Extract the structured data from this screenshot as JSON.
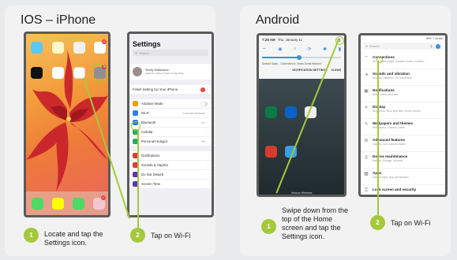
{
  "ios": {
    "title": "IOS – iPhone",
    "settings_title": "Settings",
    "search_placeholder": "Search",
    "profile_name": "Shelly Williamson",
    "profile_sub": "Apple ID, iCloud, iTunes & App Store",
    "finish_setup": "Finish Setting Up Your iPhone",
    "finish_badge": "1",
    "items": [
      {
        "label": "Airplane Mode",
        "value": "",
        "color": "#f39c12"
      },
      {
        "label": "Wi-Fi",
        "value": "Comcast Network",
        "color": "#2f80ed"
      },
      {
        "label": "Bluetooth",
        "value": "On",
        "color": "#2f80ed"
      },
      {
        "label": "Cellular",
        "value": "",
        "color": "#27ae60"
      },
      {
        "label": "Personal Hotspot",
        "value": "Off",
        "color": "#27ae60"
      }
    ],
    "items2": [
      {
        "label": "Notifications",
        "color": "#e53935"
      },
      {
        "label": "Sounds & Haptics",
        "color": "#e53935"
      },
      {
        "label": "Do Not Disturb",
        "color": "#5e35b1"
      },
      {
        "label": "Screen Time",
        "color": "#5e35b1"
      }
    ],
    "home_badges": [
      "12",
      "5",
      "17"
    ],
    "step1_number": "1",
    "step1_text": "Locate and tap the Settings icon.",
    "step2_number": "2",
    "step2_text": "Tap on Wi-Fi"
  },
  "android": {
    "title": "Android",
    "time": "7:25 AM",
    "date": "Thu, January 11",
    "notif_settings": "NOTIFICATION SETTINGS",
    "clear": "CLEAR",
    "notif_line": "Android Syste...  Connected to \"Jones Guest Network\"",
    "carrier": "Verizon Wireless",
    "status_right": "96% 7:26 AM",
    "search_placeholder": "Search",
    "items": [
      {
        "title": "Connections",
        "sub": "Wi-Fi, Data usage, Airplane mode, Location"
      },
      {
        "title": "Sounds and vibration",
        "sub": "Sounds, Vibration, Do not disturb"
      },
      {
        "title": "Notifications",
        "sub": "Block, allow, prioritize"
      },
      {
        "title": "Display",
        "sub": "Brightness, Blue light filter, Home screen"
      },
      {
        "title": "Wallpapers and themes",
        "sub": "Wallpapers, Themes, Icons"
      },
      {
        "title": "Advanced features",
        "sub": "Games, One-handed mode"
      },
      {
        "title": "Device maintenance",
        "sub": "Battery, Storage, Memory"
      },
      {
        "title": "Apps",
        "sub": "Default apps, App permissions"
      },
      {
        "title": "Lock screen and security",
        "sub": ""
      }
    ],
    "step1_number": "1",
    "step1_text": "Swipe down from the top of the Home screen and tap the Settings icon.",
    "step2_number": "2",
    "step2_text": "Tap on Wi-Fi"
  }
}
